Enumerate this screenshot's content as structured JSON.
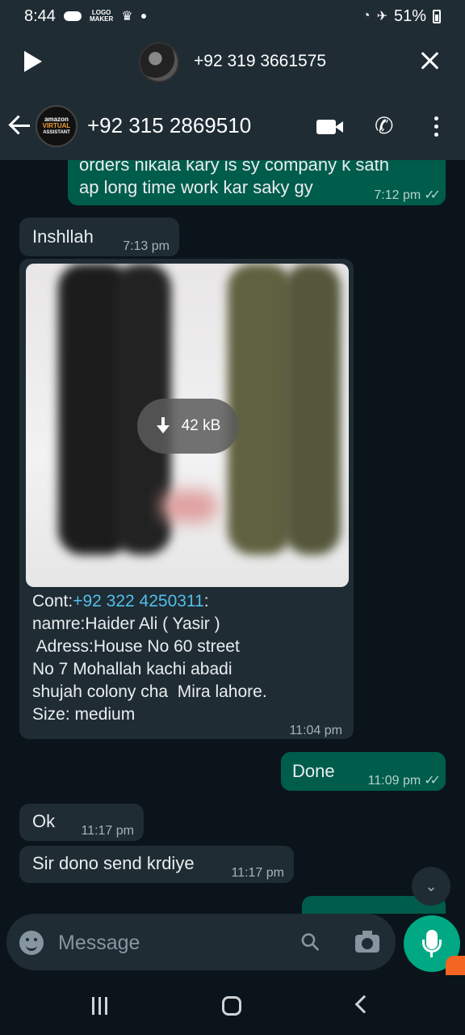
{
  "status_bar": {
    "time": "8:44",
    "logo_text_1": "LOGO",
    "logo_text_2": "MAKER",
    "battery": "51%"
  },
  "call_bar": {
    "number": "+92 319 3661575"
  },
  "header": {
    "contact_name": "+92 315 2869510",
    "avatar_line1": "amazon",
    "avatar_line2": "VIRTUAL",
    "avatar_line3": "ASSISTANT"
  },
  "messages": {
    "m1_line1": "orders nikala kary is sy company k sath",
    "m1_line2": "ap long time work kar saky gy",
    "m1_time": "7:12 pm",
    "m2_text": "Inshllah",
    "m2_time": "7:13 pm",
    "m3_size": "42 kB",
    "m3_cont_label": "Cont:",
    "m3_cont_number": "+92 322 4250311",
    "m3_cont_after": ":",
    "m3_line2": "namre:Haider Ali ( Yasir )",
    "m3_line3": " Adress:House No 60 street",
    "m3_line4": "No 7 Mohallah kachi abadi",
    "m3_line5": "shujah colony cha  Mira lahore.",
    "m3_line6": "Size: medium",
    "m3_time": "11:04 pm",
    "m4_text": "Done",
    "m4_time": "11:09 pm",
    "m5_text": "Ok",
    "m5_time": "11:17 pm",
    "m6_text": "Sir dono send krdiye",
    "m6_time": "11:17 pm"
  },
  "input": {
    "placeholder": "Message"
  },
  "icons": {
    "checkmarks": "✓✓",
    "phone": "✆",
    "attach": "⚲",
    "scroll_down": "⌄"
  },
  "colors": {
    "outgoing_bubble": "#005c4b",
    "incoming_bubble": "#1f2c34",
    "accent": "#00a884",
    "link": "#53bdeb"
  }
}
